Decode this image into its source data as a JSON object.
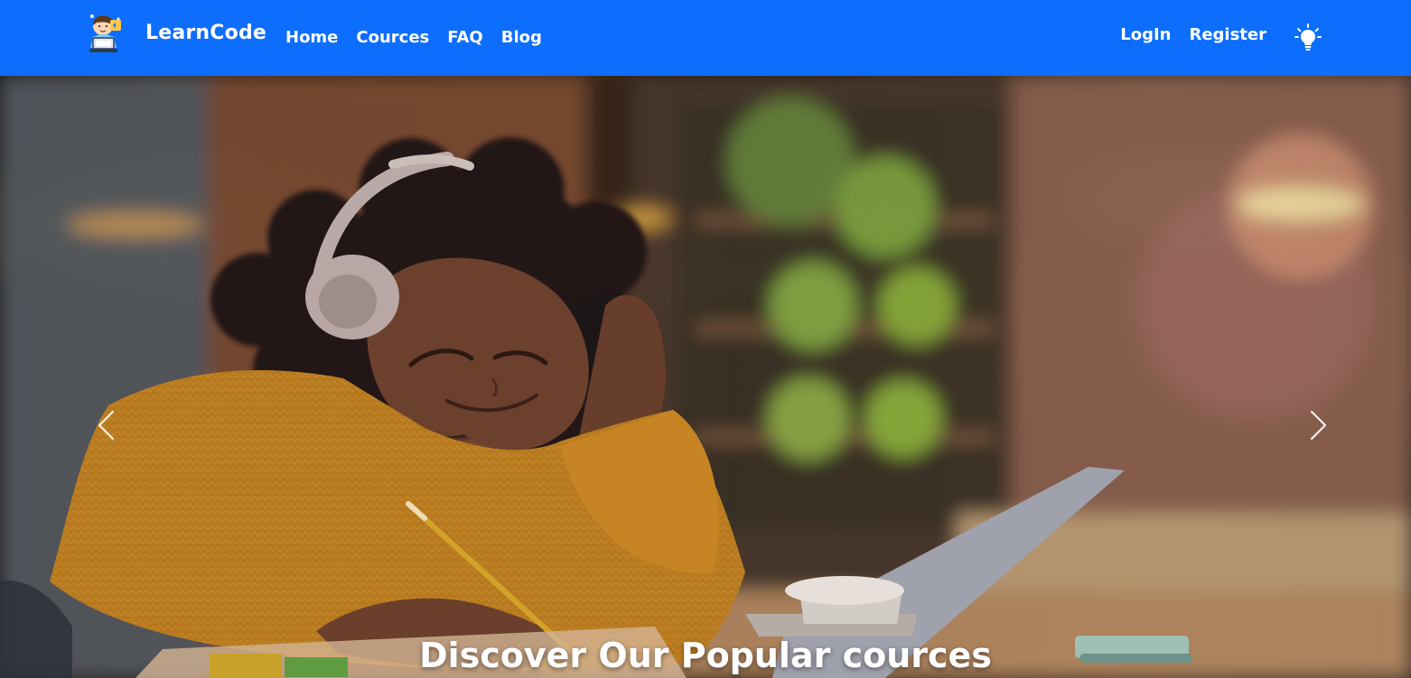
{
  "navbar": {
    "brand_name": "LearnCode",
    "links": [
      {
        "label": "Home"
      },
      {
        "label": "Cources"
      },
      {
        "label": "FAQ"
      },
      {
        "label": "Blog"
      }
    ],
    "auth_links": [
      {
        "label": "LogIn"
      },
      {
        "label": "Register"
      }
    ],
    "theme_icon": "lightbulb-icon",
    "brand_icon": "student-laptop-icon",
    "background_color": "#0d6efd"
  },
  "hero": {
    "caption": "Discover Our Popular cources",
    "prev_icon": "chevron-left-icon",
    "next_icon": "chevron-right-icon"
  }
}
